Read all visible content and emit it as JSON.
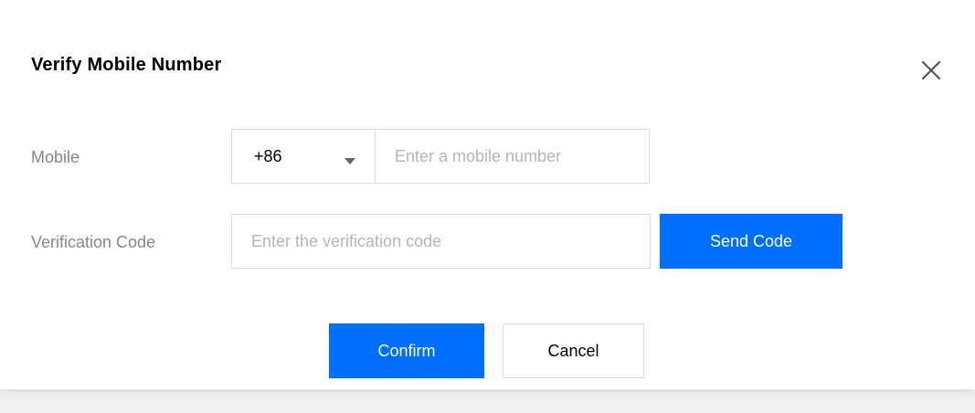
{
  "dialog": {
    "title": "Verify Mobile Number",
    "close_icon": "close-icon"
  },
  "form": {
    "mobile": {
      "label": "Mobile",
      "country_code": "+86",
      "value": "",
      "placeholder": "Enter a mobile number"
    },
    "verification_code": {
      "label": "Verification Code",
      "value": "",
      "placeholder": "Enter the verification code",
      "send_button_label": "Send Code"
    }
  },
  "actions": {
    "confirm_label": "Confirm",
    "cancel_label": "Cancel"
  },
  "colors": {
    "primary": "#006eff",
    "border": "#dcdcdc",
    "label": "#888888",
    "placeholder": "#b5b5b5"
  }
}
